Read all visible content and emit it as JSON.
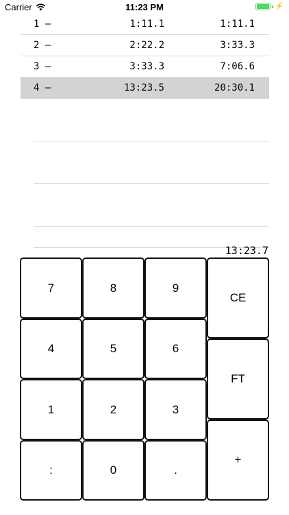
{
  "status_bar": {
    "carrier": "Carrier",
    "time": "11:23 PM",
    "wifi_icon": "wifi-icon",
    "battery_icon": "battery-icon",
    "charging_icon": "charging-bolt-icon",
    "battery_color": "#4cd964"
  },
  "laps": [
    {
      "index": "1 –",
      "split": "1:11.1",
      "total": "1:11.1",
      "selected": false
    },
    {
      "index": "2 –",
      "split": "2:22.2",
      "total": "3:33.3",
      "selected": false
    },
    {
      "index": "3 –",
      "split": "3:33.3",
      "total": "7:06.6",
      "selected": false
    },
    {
      "index": "4 –",
      "split": "13:23.5",
      "total": "20:30.1",
      "selected": true
    }
  ],
  "current_time": "13:23.7",
  "keypad": {
    "k7": "7",
    "k8": "8",
    "k9": "9",
    "ce": "CE",
    "k4": "4",
    "k5": "5",
    "k6": "6",
    "ft": "FT",
    "k1": "1",
    "k2": "2",
    "k3": "3",
    "colon": ":",
    "k0": "0",
    "dot": ".",
    "plus": "+"
  },
  "colors": {
    "selected_row": "#d3d3d3",
    "key_border": "#111111"
  }
}
